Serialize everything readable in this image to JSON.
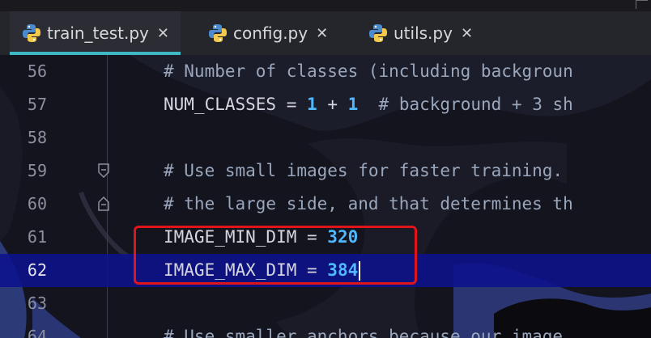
{
  "tabs": [
    {
      "label": "train_test.py",
      "close": "✕",
      "icon": "python-file-icon",
      "active": true
    },
    {
      "label": "config.py",
      "close": "✕",
      "icon": "python-file-icon",
      "active": false
    },
    {
      "label": "utils.py",
      "close": "✕",
      "icon": "python-file-icon",
      "active": false
    }
  ],
  "editor": {
    "current_line": "62",
    "highlight_color": "#e0151c",
    "accent": "#3db8c4",
    "lines": [
      {
        "number": "56",
        "comment": "# Number of classes (including backgroun"
      },
      {
        "number": "57",
        "code": "NUM_CLASSES = ",
        "v1": "1",
        "op": " + ",
        "v2": "1",
        "comment": "  # background + 3 sh"
      },
      {
        "number": "58"
      },
      {
        "number": "59",
        "comment": "# Use small images for faster training. "
      },
      {
        "number": "60",
        "comment": "# the large side, and that determines th"
      },
      {
        "number": "61",
        "code": "IMAGE_MIN_DIM = ",
        "value": "320"
      },
      {
        "number": "62",
        "code": "IMAGE_MAX_DIM = ",
        "value": "384"
      },
      {
        "number": "63"
      },
      {
        "number": "64",
        "comment": "# Use smaller anchors because our image "
      }
    ]
  }
}
